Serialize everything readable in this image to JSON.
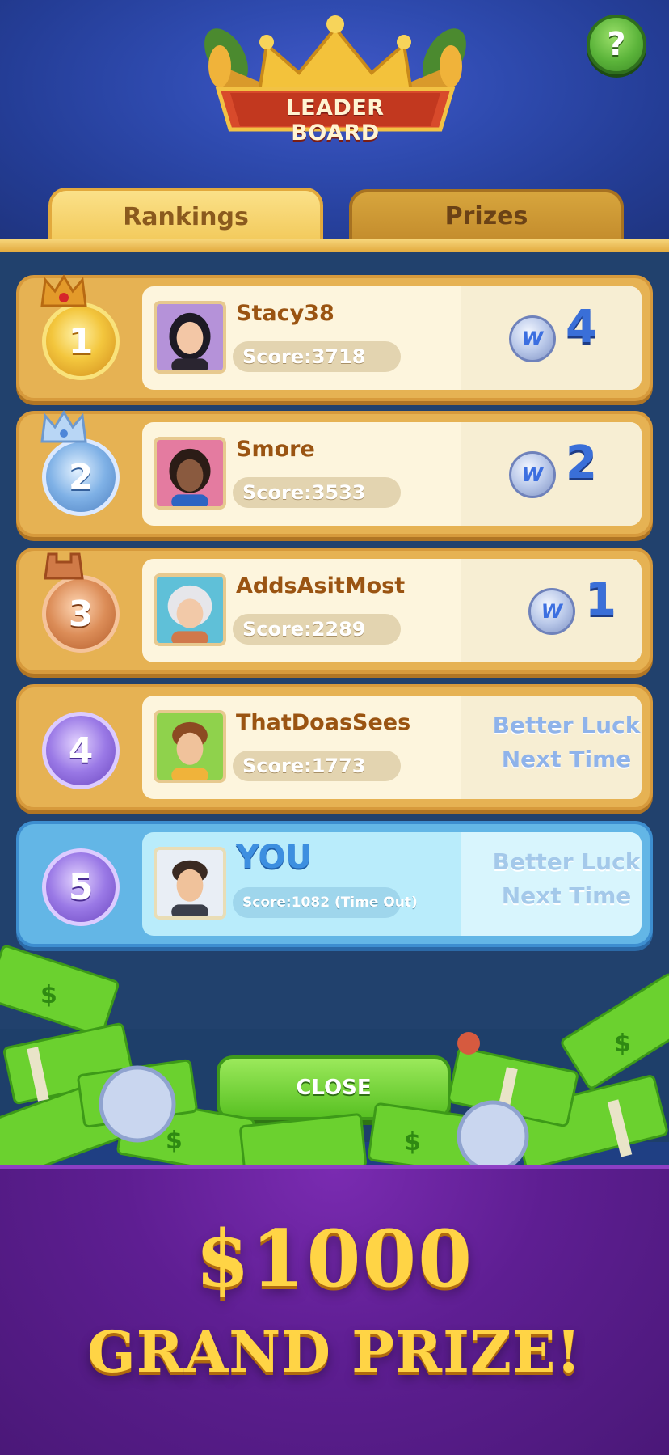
{
  "header": {
    "logo_text": "LEADER BOARD",
    "help_label": "?"
  },
  "tabs": [
    {
      "label": "Rankings",
      "active": true
    },
    {
      "label": "Prizes",
      "active": false
    }
  ],
  "rankings": [
    {
      "rank": "1",
      "medal": "gold",
      "name": "Stacy38",
      "score": "Score:3718",
      "prize_icon": "w-coin-icon",
      "prize": "4"
    },
    {
      "rank": "2",
      "medal": "silver",
      "name": "Smore",
      "score": "Score:3533",
      "prize_icon": "w-coin-icon",
      "prize": "2"
    },
    {
      "rank": "3",
      "medal": "bronze",
      "name": "AddsAsitMost",
      "score": "Score:2289",
      "prize_icon": "w-coin-icon",
      "prize": "1"
    },
    {
      "rank": "4",
      "medal": "purple",
      "name": "ThatDoasSees",
      "score": "Score:1773",
      "luck_line1": "Better Luck",
      "luck_line2": "Next Time"
    },
    {
      "rank": "5",
      "medal": "purple",
      "name": "YOU",
      "score": "Score:1082 (Time Out)",
      "luck_line1": "Better Luck",
      "luck_line2": "Next Time",
      "is_you": true
    }
  ],
  "close_label": "CLOSE",
  "promo": {
    "amount": "$1000",
    "subtitle": "GRAND PRIZE!"
  },
  "colors": {
    "header_bg": "#2f4bb0",
    "board_bg": "#21416d",
    "row_gold": "#e6b253",
    "row_you": "#63b6e6",
    "close_green": "#59c123",
    "promo_purple": "#5e1e92",
    "promo_gold": "#ffd445"
  }
}
